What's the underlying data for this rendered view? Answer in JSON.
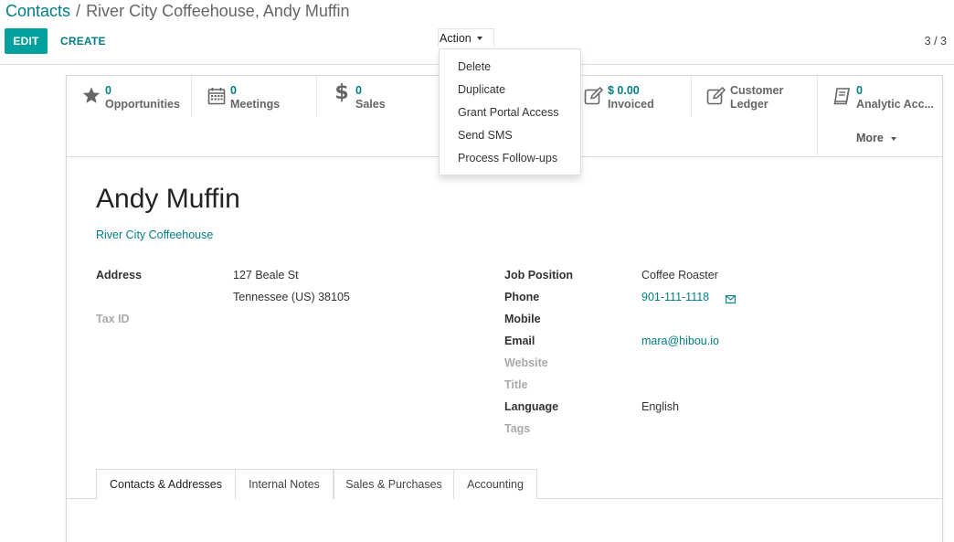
{
  "breadcrumb": {
    "parent": "Contacts",
    "separator": "/",
    "current": "River City Coffeehouse, Andy Muffin"
  },
  "toolbar": {
    "edit_label": "EDIT",
    "create_label": "CREATE",
    "action_label": "Action",
    "pager": "3 / 3"
  },
  "action_menu": [
    "Delete",
    "Duplicate",
    "Grant Portal Access",
    "Send SMS",
    "Process Follow-ups"
  ],
  "stat_buttons": [
    {
      "icon": "star-icon",
      "value": "0",
      "label": "Opportunities"
    },
    {
      "icon": "calendar-icon",
      "value": "0",
      "label": "Meetings"
    },
    {
      "icon": "dollar-icon",
      "value": "0",
      "label": "Sales"
    },
    {
      "icon": "edit-icon",
      "value": "$ 0.00",
      "label": "Invoiced"
    },
    {
      "icon": "edit-icon",
      "value": "",
      "label": "Customer Ledger"
    },
    {
      "icon": "book-icon",
      "value": "0",
      "label": "Analytic Acc..."
    }
  ],
  "more_label": "More",
  "record": {
    "name": "Andy Muffin",
    "company": "River City Coffeehouse",
    "address_label": "Address",
    "address_line1": "127 Beale St",
    "address_line2": "Tennessee (US)  38105",
    "tax_id_label": "Tax ID",
    "job_position_label": "Job Position",
    "job_position": "Coffee Roaster",
    "phone_label": "Phone",
    "phone": "901-111-1118",
    "mobile_label": "Mobile",
    "email_label": "Email",
    "email": "mara@hibou.io",
    "website_label": "Website",
    "title_label": "Title",
    "language_label": "Language",
    "language": "English",
    "tags_label": "Tags"
  },
  "tabs": [
    "Contacts & Addresses",
    "Internal Notes",
    "Sales & Purchases",
    "Accounting"
  ],
  "colors": {
    "accent": "#017e84",
    "primary_button": "#00a09d"
  }
}
